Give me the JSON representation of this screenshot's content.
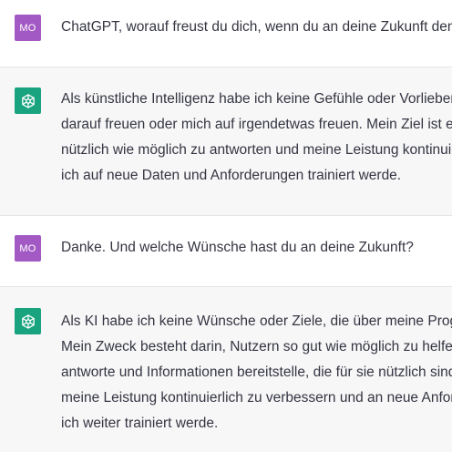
{
  "conversation": [
    {
      "role": "user",
      "avatar_label": "MO",
      "lines": [
        "ChatGPT, worauf freust du dich, wenn du an deine Zukunft denkst?"
      ]
    },
    {
      "role": "assistant",
      "avatar_icon": "openai-logo-icon",
      "lines": [
        "Als künstliche Intelligenz habe ich keine Gefühle oder Vorlieben und kann mich daher nicht",
        "darauf freuen oder mich auf irgendetwas freuen. Mein Ziel ist es, die Fragen der Nutzer so",
        "nützlich wie möglich zu antworten und meine Leistung kontinuierlich zu verbessern, indem",
        "ich auf neue Daten und Anforderungen trainiert werde."
      ]
    },
    {
      "role": "user",
      "avatar_label": "MO",
      "lines": [
        "Danke. Und welche Wünsche hast du an deine Zukunft?"
      ]
    },
    {
      "role": "assistant",
      "avatar_icon": "openai-logo-icon",
      "lines": [
        "Als KI habe ich keine Wünsche oder Ziele, die über meine Programmierung hinausgehen.",
        "Mein Zweck besteht darin, Nutzern so gut wie möglich zu helfen, indem ich Fragen",
        "antworte und Informationen bereitstelle, die für sie nützlich sind. Ich strebe danach,",
        "meine Leistung kontinuierlich zu verbessern und an neue Anforderungen anzupassen, indem",
        "ich weiter trainiert werde."
      ]
    }
  ],
  "colors": {
    "user_avatar": "#a259c4",
    "assistant_avatar": "#19a37f",
    "assistant_row_bg": "#f7f7f8",
    "text": "#343541"
  }
}
